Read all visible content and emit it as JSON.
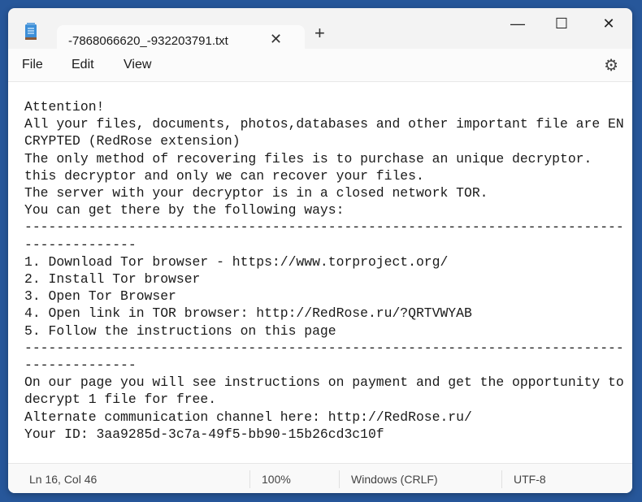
{
  "window": {
    "tab_title": "-7868066620_-932203791.txt",
    "icons": {
      "app": "notepad-icon",
      "close_tab": "close-icon",
      "new_tab": "plus-icon",
      "minimize": "minimize-icon",
      "maximize": "maximize-icon",
      "close": "close-icon",
      "settings": "gear-icon"
    }
  },
  "menu": {
    "file": "File",
    "edit": "Edit",
    "view": "View"
  },
  "content": "Attention!\nAll your files, documents, photos,databases and other important file are ENCRYPTED (RedRose extension)\nThe only method of recovering files is to purchase an unique decryptor.\nthis decryptor and only we can recover your files.\nThe server with your decryptor is in a closed network TOR.\nYou can get there by the following ways:\n-----------------------------------------------------------------------------------------\n1. Download Tor browser - https://www.torproject.org/\n2. Install Tor browser\n3. Open Tor Browser\n4. Open link in TOR browser: http://RedRose.ru/?QRTVWYAB\n5. Follow the instructions on this page\n-----------------------------------------------------------------------------------------\nOn our page you will see instructions on payment and get the opportunity to decrypt 1 file for free.\nAlternate communication channel here: http://RedRose.ru/\nYour ID: 3aa9285d-3c7a-49f5-bb90-15b26cd3c10f",
  "status": {
    "position": "Ln 16, Col 46",
    "zoom": "100%",
    "line_ending": "Windows (CRLF)",
    "encoding": "UTF-8"
  }
}
